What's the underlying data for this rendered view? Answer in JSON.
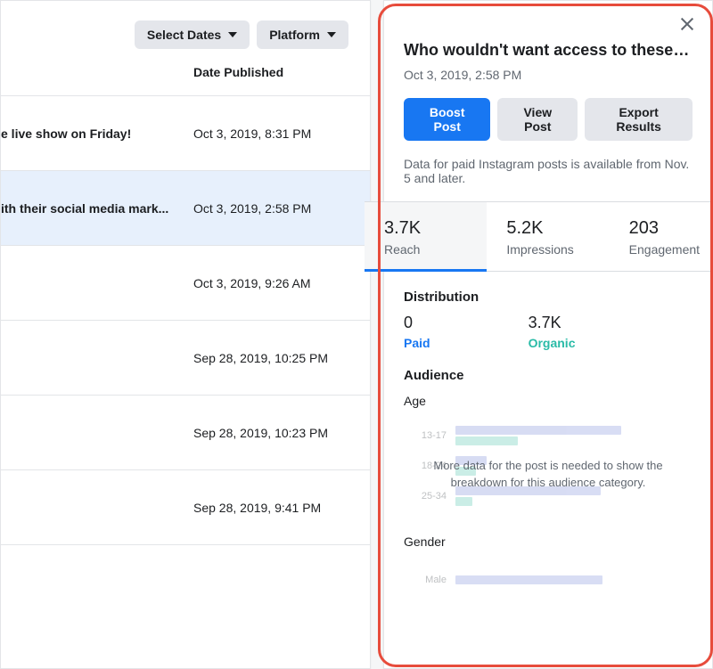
{
  "toolbar": {
    "dates_label": "Select Dates",
    "platform_label": "Platform"
  },
  "table": {
    "column_header": "Date Published",
    "rows": [
      {
        "title": "e live show on Friday!",
        "date": "Oct 3, 2019, 8:31 PM",
        "selected": false
      },
      {
        "title": "ith their social media mark...",
        "date": "Oct 3, 2019, 2:58 PM",
        "selected": true
      },
      {
        "title": "",
        "date": "Oct 3, 2019, 9:26 AM",
        "selected": false
      },
      {
        "title": "",
        "date": "Sep 28, 2019, 10:25 PM",
        "selected": false
      },
      {
        "title": "",
        "date": "Sep 28, 2019, 10:23 PM",
        "selected": false
      },
      {
        "title": "",
        "date": "Sep 28, 2019, 9:41 PM",
        "selected": false
      }
    ]
  },
  "detail": {
    "title": "Who wouldn't want access to these four (slightl...",
    "timestamp": "Oct 3, 2019, 2:58 PM",
    "buttons": {
      "boost": "Boost Post",
      "view": "View Post",
      "export": "Export Results"
    },
    "note": "Data for paid Instagram posts is available from Nov. 5 and later.",
    "metrics": [
      {
        "value": "3.7K",
        "label": "Reach",
        "active": true
      },
      {
        "value": "5.2K",
        "label": "Impressions",
        "active": false
      },
      {
        "value": "203",
        "label": "Engagement",
        "active": false
      }
    ],
    "distribution": {
      "header": "Distribution",
      "paid": {
        "value": "0",
        "label": "Paid"
      },
      "organic": {
        "value": "3.7K",
        "label": "Organic"
      }
    },
    "audience": {
      "header": "Audience",
      "age_label": "Age",
      "gender_label": "Gender",
      "overlay_msg": "More data for the post is needed to show the breakdown for this audience category."
    }
  },
  "chart_data": {
    "type": "bar",
    "orientation": "horizontal",
    "title": "Age",
    "categories": [
      "13-17",
      "18-24",
      "25-34"
    ],
    "series": [
      {
        "name": "Paid",
        "color": "#b8c1eb",
        "values": [
          80,
          15,
          70
        ]
      },
      {
        "name": "Organic",
        "color": "#9fdfd2",
        "values": [
          30,
          10,
          8
        ]
      }
    ],
    "note": "values are approximate relative bar lengths read from faded preview; no axis ticks visible"
  }
}
